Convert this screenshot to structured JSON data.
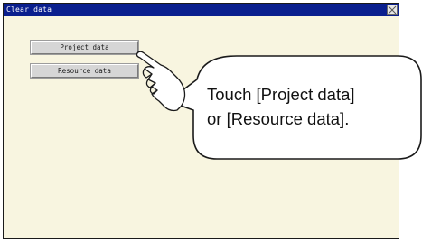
{
  "window": {
    "title": "Clear data",
    "close_icon": "close-x-icon",
    "title_bar_color": "#0a1f8e",
    "background_color": "#f8f5e0"
  },
  "buttons": {
    "project_data": "Project data",
    "resource_data": "Resource data"
  },
  "callout": {
    "line1": "Touch [Project data]",
    "line2": "or [Resource data]."
  },
  "hand_icon": "pointing-hand-icon"
}
